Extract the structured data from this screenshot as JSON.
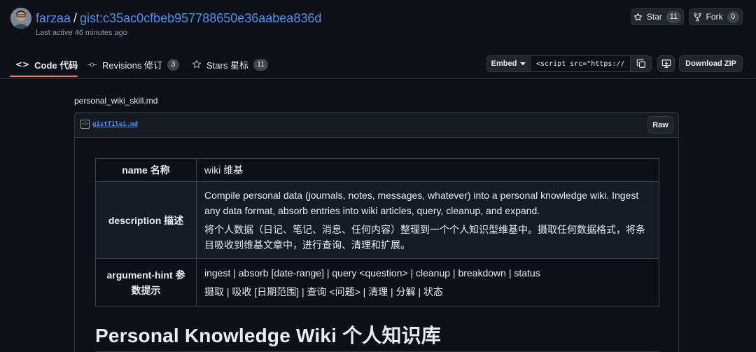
{
  "header": {
    "owner": "farzaa",
    "separator": "/",
    "gist_name": "gist:c35ac0cfbeb957788650e36aabea836d",
    "last_active": "Last active 46 minutes ago",
    "star_label": "Star",
    "star_count": "11",
    "fork_label": "Fork",
    "fork_count": "0"
  },
  "tabs": [
    {
      "label": "Code 代码",
      "icon": "code-icon",
      "active": true
    },
    {
      "label": "Revisions 修订",
      "count": "3",
      "icon": "git-commit-icon"
    },
    {
      "label": "Stars 星标",
      "count": "11",
      "icon": "star-icon"
    }
  ],
  "toolbar": {
    "embed_label": "Embed",
    "embed_value": "<script src=\"https://",
    "download_label": "Download ZIP"
  },
  "file": {
    "outer_name": "personal_wiki_skill.md",
    "name": "gistfile1.md",
    "raw_label": "Raw"
  },
  "frontmatter": [
    {
      "key": "name 名称",
      "values": [
        "wiki 维基"
      ]
    },
    {
      "key": "description 描述",
      "values": [
        "Compile personal data (journals, notes, messages, whatever) into a personal knowledge wiki. Ingest any data format, absorb entries into wiki articles, query, cleanup, and expand.",
        "将个人数据（日记、笔记、消息、任何内容）整理到一个个人知识型维基中。摄取任何数据格式，将条目吸收到维基文章中，进行查询、清理和扩展。"
      ]
    },
    {
      "key": "argument-hint 参数提示",
      "values": [
        "ingest | absorb [date-range] | query <question> | cleanup | breakdown | status",
        "摄取 | 吸收 [日期范围] | 查询 <问题> | 清理 | 分解 | 状态"
      ]
    }
  ],
  "doc": {
    "heading": "Personal Knowledge Wiki 个人知识库"
  },
  "colors": {
    "background": "#0d1117",
    "link": "#4493f8",
    "tab_underline": "#f78166",
    "border": "#30363d"
  }
}
